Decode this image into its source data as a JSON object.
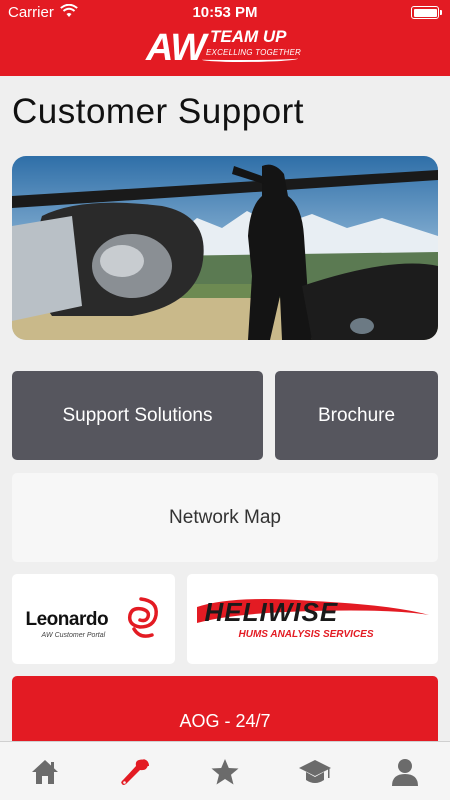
{
  "status_bar": {
    "carrier": "Carrier",
    "time": "10:53 PM"
  },
  "header": {
    "logo_main": "AW",
    "logo_team": "TEAM UP",
    "logo_tagline": "EXCELLING TOGETHER",
    "color": "#e31b23"
  },
  "page": {
    "title": "Customer Support"
  },
  "tiles": {
    "support_solutions": "Support Solutions",
    "brochure": "Brochure",
    "network_map": "Network Map"
  },
  "partners": {
    "leonardo_name": "Leonardo",
    "leonardo_sub": "AW Customer Portal",
    "heliwise_name": "HELIWISE",
    "heliwise_sub": "HUMS ANALYSIS SERVICES"
  },
  "aog": {
    "label": "AOG - 24/7"
  },
  "tabbar": {
    "items": [
      {
        "icon": "home-icon",
        "active": false
      },
      {
        "icon": "wrench-icon",
        "active": true
      },
      {
        "icon": "star-icon",
        "active": false
      },
      {
        "icon": "graduation-cap-icon",
        "active": false
      },
      {
        "icon": "user-icon",
        "active": false
      }
    ],
    "active_color": "#e31b23",
    "inactive_color": "#6b6b6b"
  }
}
